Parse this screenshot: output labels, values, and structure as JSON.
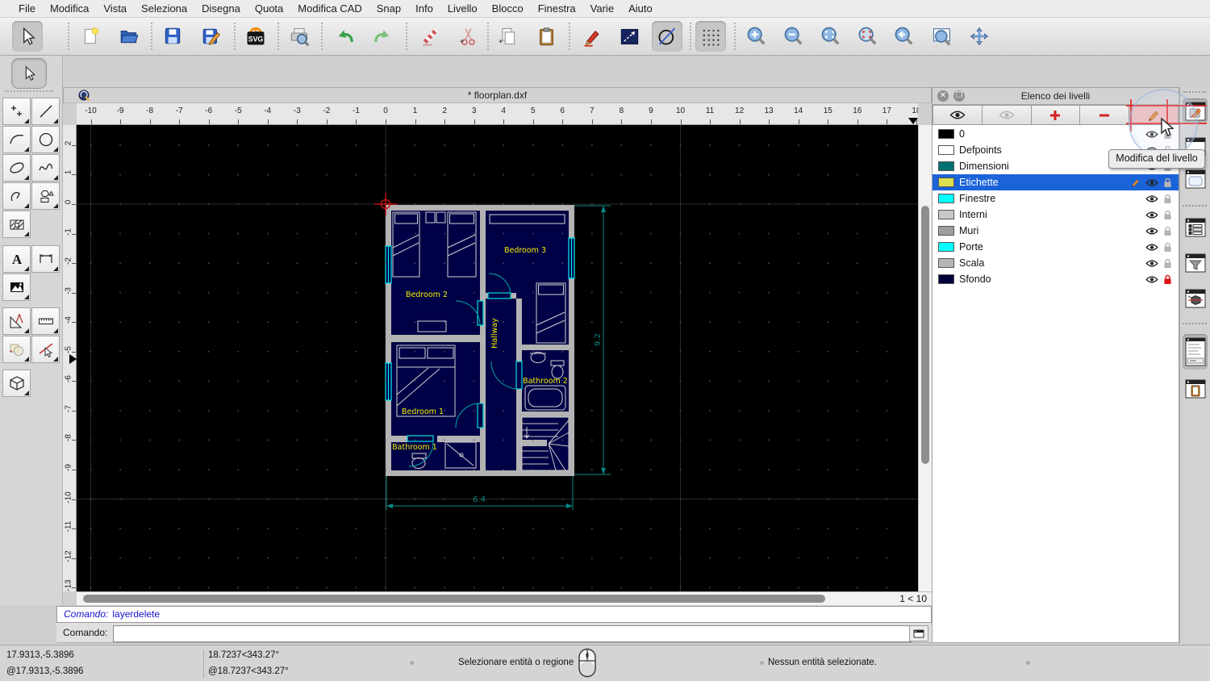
{
  "menu": {
    "items": [
      "File",
      "Modifica",
      "Vista",
      "Seleziona",
      "Disegna",
      "Quota",
      "Modifica CAD",
      "Snap",
      "Info",
      "Livello",
      "Blocco",
      "Finestra",
      "Varie",
      "Aiuto"
    ]
  },
  "toolbar": {
    "svg_badge": "SVG"
  },
  "palette": {
    "text_tool_glyph": "A"
  },
  "document": {
    "title": "* floorplan.dxf",
    "h_ruler_labels": [
      -10,
      -9,
      -8,
      -7,
      -6,
      -5,
      -4,
      -3,
      -2,
      -1,
      0,
      1,
      2,
      3,
      4,
      5,
      6,
      7,
      8,
      9,
      10,
      11,
      12,
      13,
      14,
      15,
      16,
      17,
      18
    ],
    "v_ruler_labels": [
      2,
      1,
      0,
      -1,
      -2,
      -3,
      -4,
      -5,
      -6,
      -7,
      -8,
      -9,
      -10,
      -11,
      -12,
      -13
    ],
    "scale_indicator": "1 < 10"
  },
  "floorplan": {
    "rooms": {
      "bedroom1": "Bedroom 1",
      "bedroom2": "Bedroom 2",
      "bedroom3": "Bedroom 3",
      "bathroom1": "Bathroom 1",
      "bathroom2": "Bathroom 2",
      "hallway": "Hallway"
    },
    "dimensions": {
      "width": "6.4",
      "height": "9.2"
    },
    "colors": {
      "room_fill": "#000046",
      "wall": "#b3b3b3",
      "furniture": "#d4d4d4",
      "door": "#00e0e0",
      "window": "#00f0f0",
      "dimension": "#0a8888",
      "label": "#f0f000"
    }
  },
  "layers_panel": {
    "title": "Elenco dei livelli",
    "tooltip": "Modifica del livello",
    "layers": [
      {
        "name": "0",
        "color": "#000000",
        "selected": false,
        "editing": false,
        "lock": "gray"
      },
      {
        "name": "Defpoints",
        "color": "#ffffff",
        "selected": false,
        "editing": false,
        "lock": "gray"
      },
      {
        "name": "Dimensioni",
        "color": "#007070",
        "selected": false,
        "editing": false,
        "lock": "gray"
      },
      {
        "name": "Etichette",
        "color": "#dce04e",
        "selected": true,
        "editing": true,
        "lock": "gray"
      },
      {
        "name": "Finestre",
        "color": "#00ffff",
        "selected": false,
        "editing": false,
        "lock": "gray"
      },
      {
        "name": "Interni",
        "color": "#c9c9c9",
        "selected": false,
        "editing": false,
        "lock": "gray"
      },
      {
        "name": "Muri",
        "color": "#9e9e9e",
        "selected": false,
        "editing": false,
        "lock": "gray"
      },
      {
        "name": "Porte",
        "color": "#00ffff",
        "selected": false,
        "editing": false,
        "lock": "gray"
      },
      {
        "name": "Scala",
        "color": "#b5b5b5",
        "selected": false,
        "editing": false,
        "lock": "gray"
      },
      {
        "name": "Sfondo",
        "color": "#000038",
        "selected": false,
        "editing": false,
        "lock": "red"
      }
    ]
  },
  "command": {
    "history_label": "Comando:",
    "history_value": "layerdelete",
    "prompt_label": "Comando:",
    "input_value": ""
  },
  "status": {
    "abs_coords": "17.9313,-5.3896",
    "rel_coords": "@17.9313,-5.3896",
    "polar_coords": "18.7237<343.27°",
    "polar_rel_coords": "@18.7237<343.27°",
    "hint": "Selezionare entità o regione",
    "selection_info": "Nessun entità selezionate."
  }
}
